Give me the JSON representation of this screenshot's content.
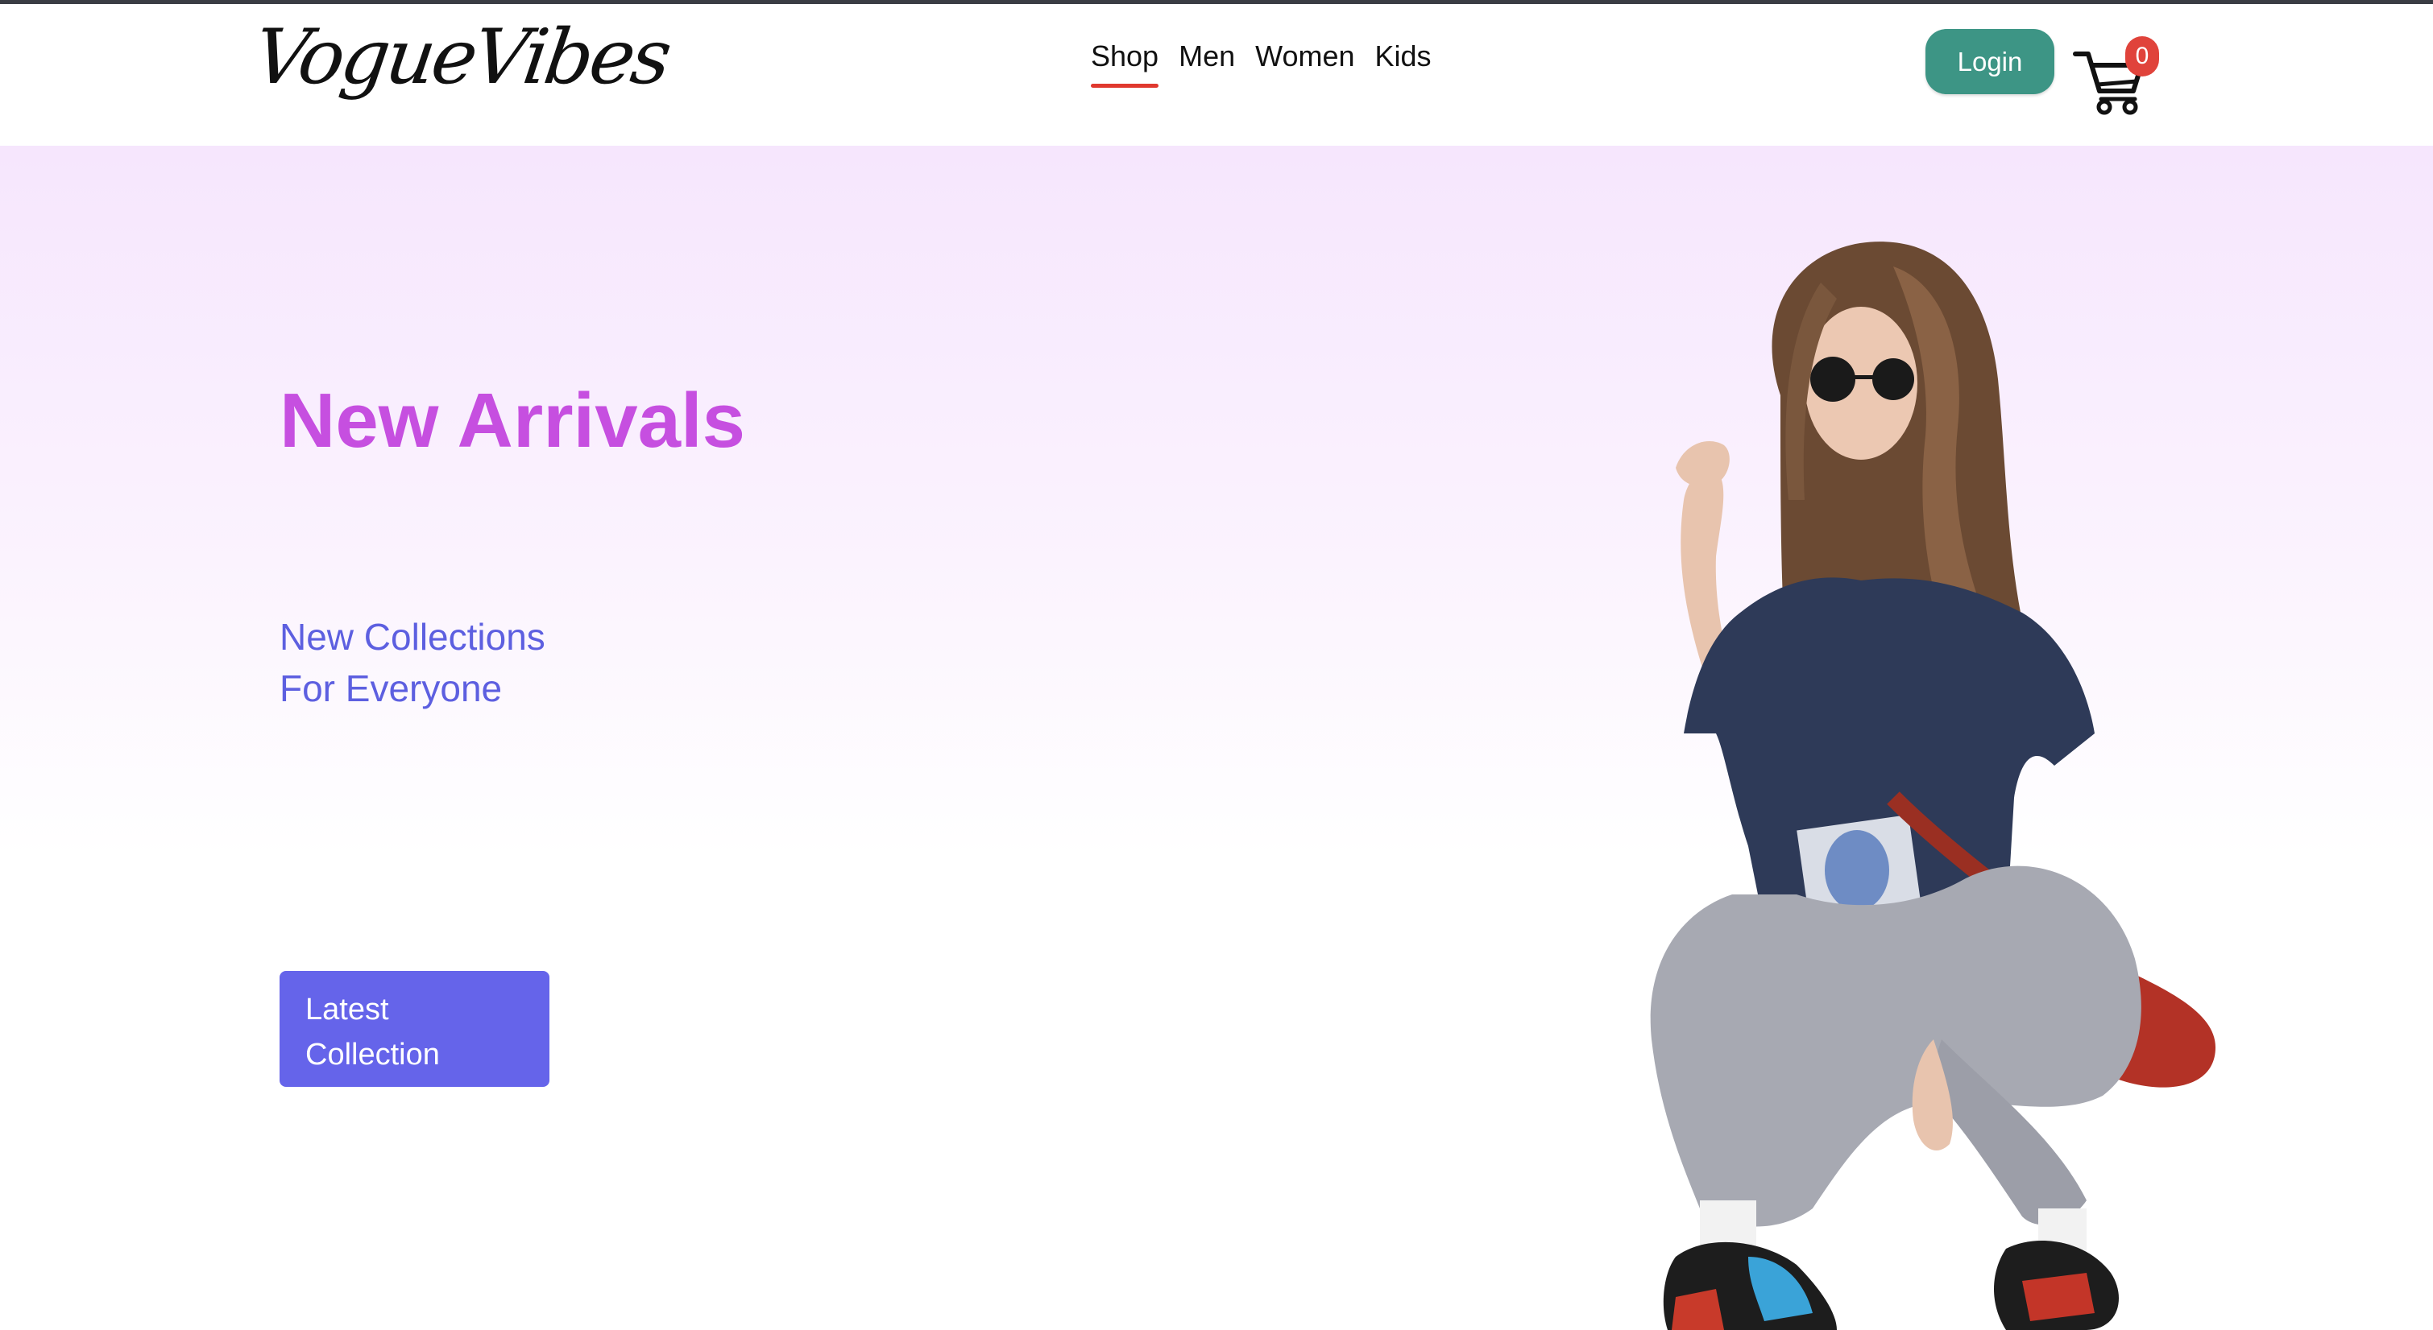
{
  "brand": {
    "logo_text": "VogueVibes"
  },
  "nav": {
    "items": [
      {
        "label": "Shop",
        "active": true
      },
      {
        "label": "Men",
        "active": false
      },
      {
        "label": "Women",
        "active": false
      },
      {
        "label": "Kids",
        "active": false
      }
    ]
  },
  "header": {
    "login_label": "Login",
    "cart_count": "0",
    "cart_icon": "shopping-cart-icon"
  },
  "hero": {
    "title": "New Arrivals",
    "subtitle_line1": "New Collections",
    "subtitle_line2": "For Everyone",
    "cta_line1": "Latest",
    "cta_line2": "Collection",
    "image_subject": "hero-model-image"
  },
  "colors": {
    "nav_active_underline": "#e0382e",
    "login_button": "#3d9585",
    "cart_badge": "#e0433b",
    "hero_title": "#c64fe0",
    "hero_subtitle": "#5d5fe0",
    "cta_button": "#6564ea",
    "hero_gradient_top": "#f6e6fd"
  }
}
